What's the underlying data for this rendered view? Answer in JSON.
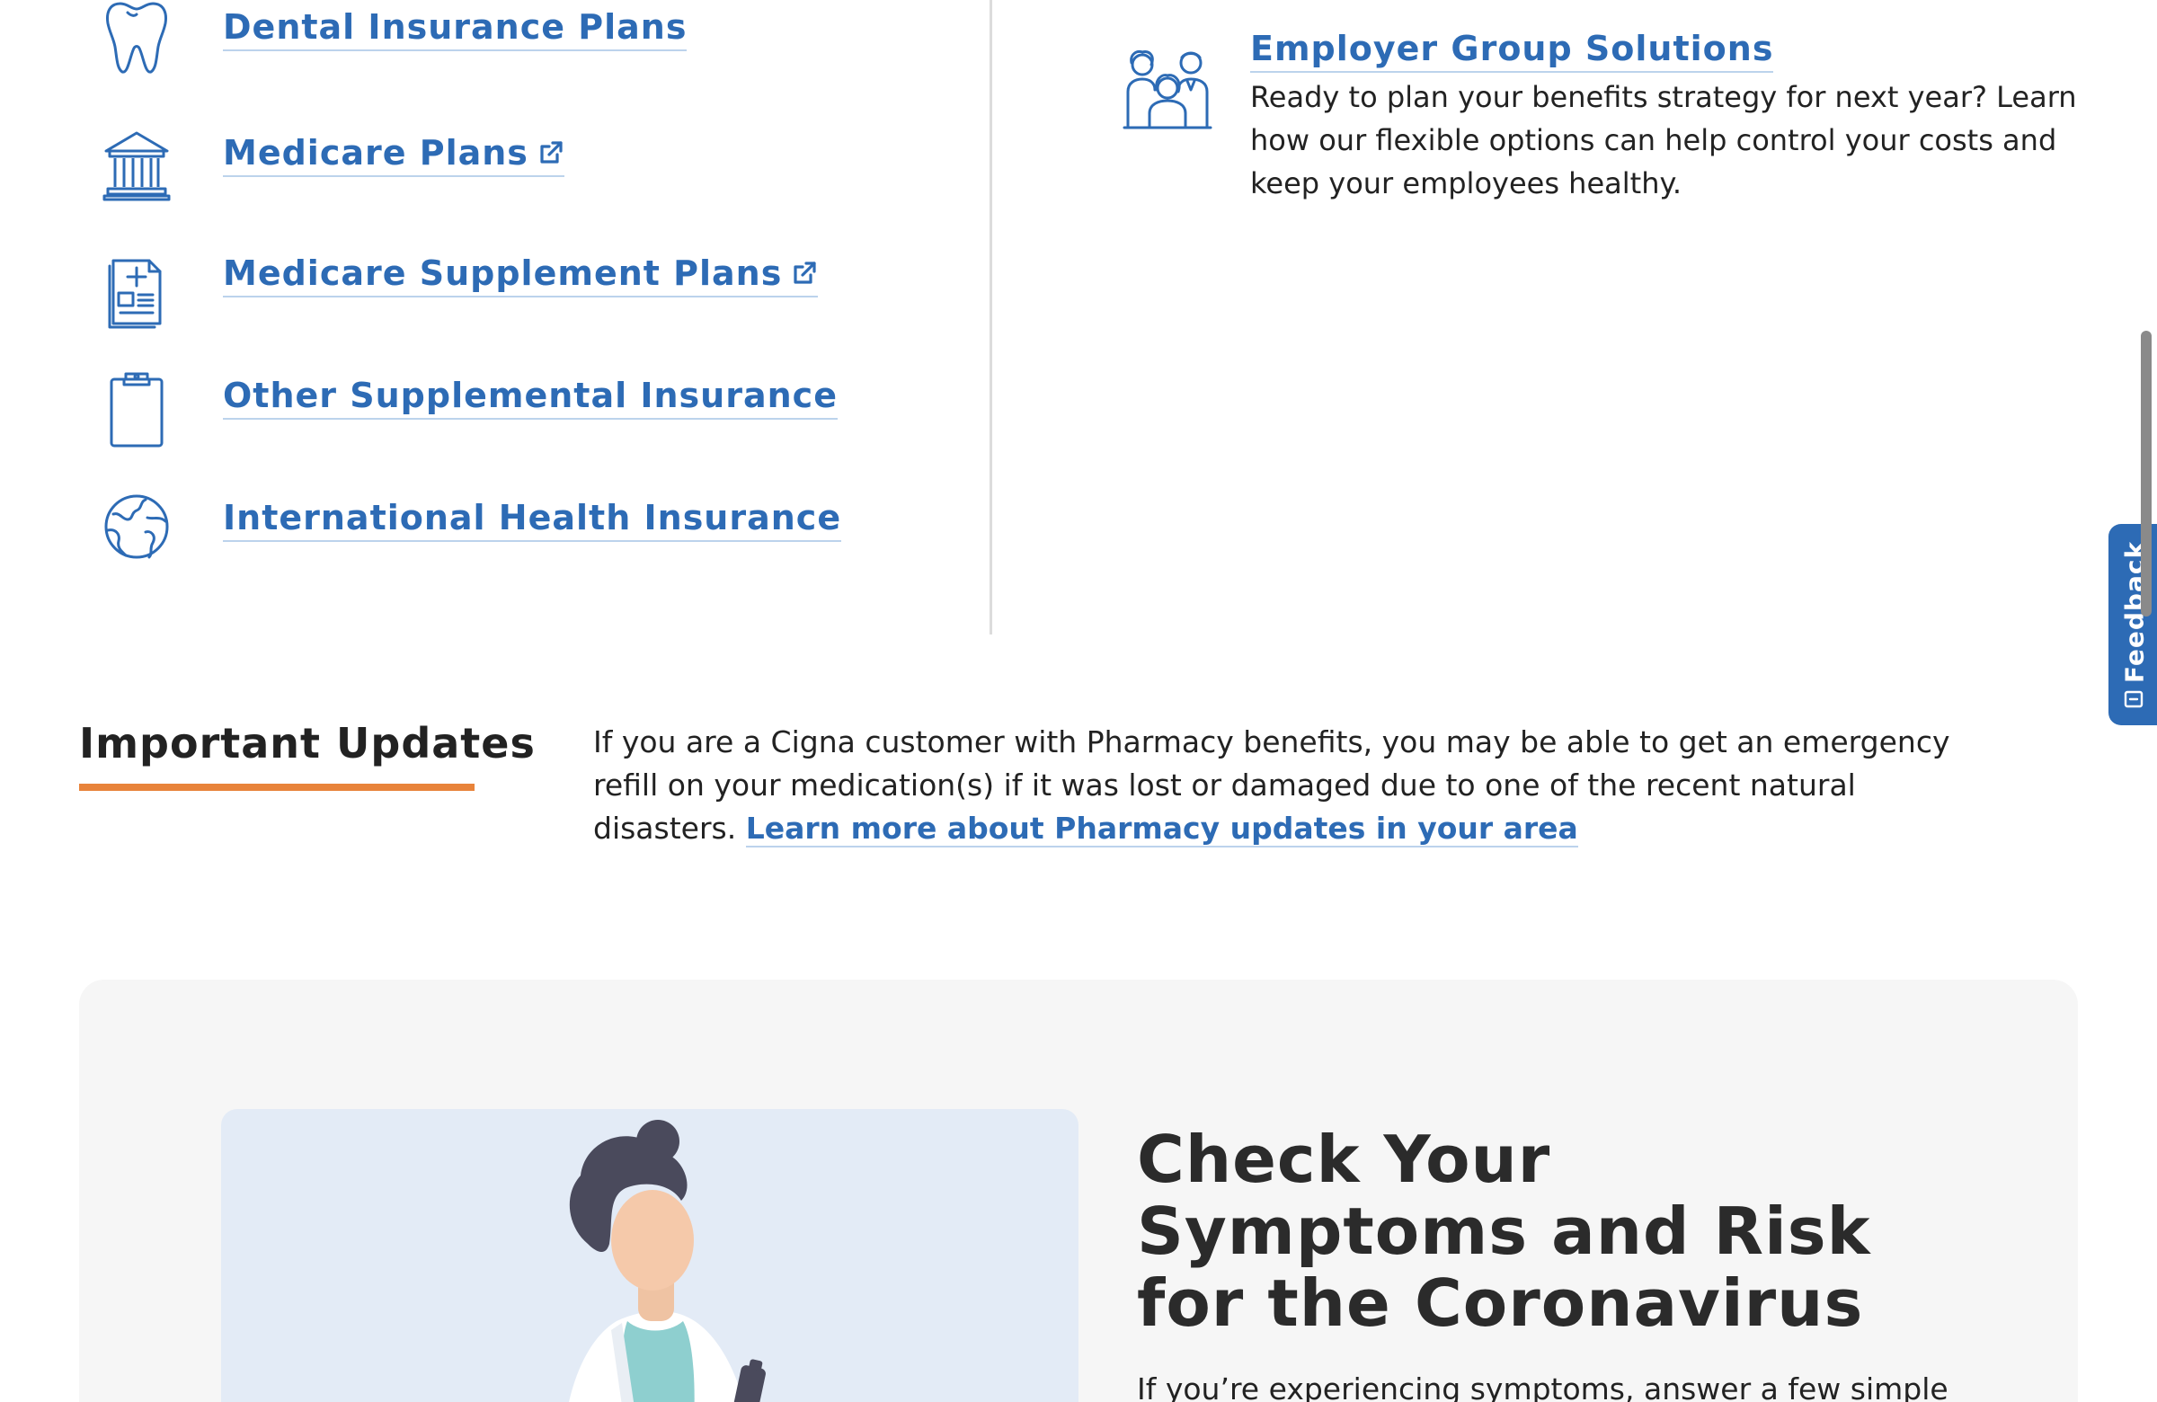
{
  "plans": {
    "items": [
      {
        "label": "Dental Insurance Plans",
        "icon": "tooth-icon",
        "external": false
      },
      {
        "label": "Medicare Plans",
        "icon": "bank-building-icon",
        "external": true
      },
      {
        "label": "Medicare Supplement Plans",
        "icon": "medical-document-icon",
        "external": true
      },
      {
        "label": "Other Supplemental Insurance",
        "icon": "clipboard-icon",
        "external": false
      },
      {
        "label": "International Health Insurance",
        "icon": "globe-icon",
        "external": false
      }
    ]
  },
  "employer": {
    "title": "Employer Group Solutions",
    "description": "Ready to plan your benefits strategy for next year? Learn how our flexible options can help control your costs and keep your employees healthy.",
    "icon": "group-people-icon"
  },
  "updates": {
    "heading": "Important Updates",
    "body": "If you are a Cigna customer with Pharmacy benefits, you may be able to get an emergency refill on your medication(s) if it was lost or damaged due to one of the recent natural disasters.",
    "link": "Learn more about Pharmacy updates in your area"
  },
  "symptoms_card": {
    "title": "Check Your Symptoms and Risk for the Coronavirus",
    "body": "If you’re experiencing symptoms, answer a few simple"
  },
  "feedback": {
    "label": "Feedback",
    "icon": "feedback-icon"
  },
  "colors": {
    "link_blue": "#2d6bb5",
    "accent_orange": "#e8833a",
    "card_background": "#f6f6f6",
    "image_background": "#e3ebf6"
  }
}
